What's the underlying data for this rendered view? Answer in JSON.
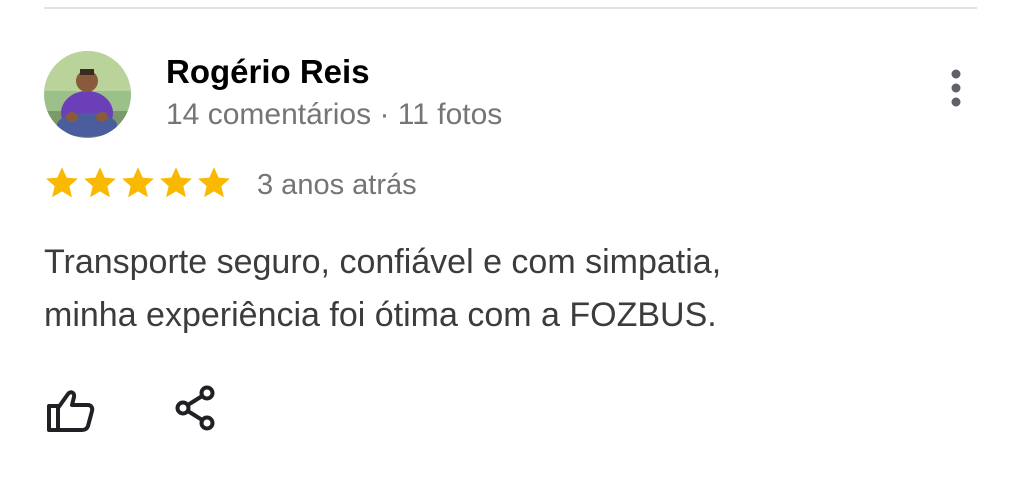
{
  "reviewer": {
    "name": "Rogério Reis",
    "meta": "14 comentários · 11 fotos",
    "avatar_icon": "user-avatar-photo"
  },
  "review": {
    "rating": 5,
    "rating_max": 5,
    "time_ago": "3 anos atrás",
    "text_lines": [
      "Transporte seguro, confiável e com simpatia,",
      "minha experiência foi ótima com a FOZBUS."
    ]
  },
  "actions": {
    "like_icon": "thumbs-up-icon",
    "share_icon": "share-icon",
    "more_icon": "more-vertical-icon"
  },
  "colors": {
    "star": "#f9b900",
    "name": "#000000",
    "meta": "#757575",
    "body_text": "#3c3c3c",
    "icon": "#202124",
    "divider": "#e3e3e3"
  }
}
